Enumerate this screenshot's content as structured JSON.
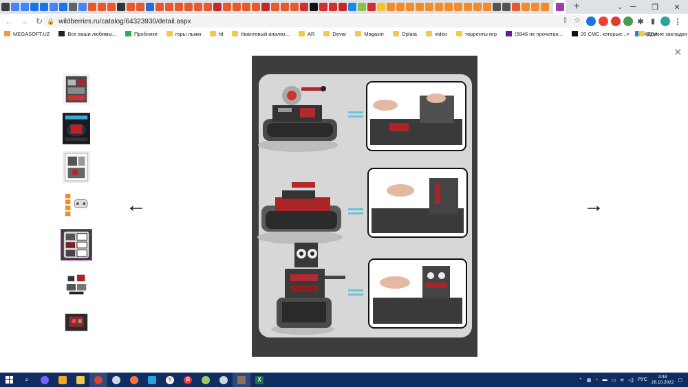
{
  "browser": {
    "active_tab_close": "×",
    "new_tab": "+",
    "tab_search": "⌄",
    "window": {
      "minimize": "─",
      "maximize": "❐",
      "close": "✕"
    },
    "url": "wildberries.ru/catalog/64323930/detail.aspx",
    "bookmarks": [
      {
        "label": "MEGASOFT.UZ",
        "color": "#e8a13a",
        "folder": false
      },
      {
        "label": "Все ваши любимы...",
        "color": "#222222",
        "folder": false
      },
      {
        "label": "Пробники",
        "color": "#34a853",
        "folder": false
      },
      {
        "label": "горы лыжи",
        "color": "#f2c94c",
        "folder": true
      },
      {
        "label": "fd",
        "color": "#f2c94c",
        "folder": true
      },
      {
        "label": "Квантовый анализ...",
        "color": "#f2c94c",
        "folder": true
      },
      {
        "label": "AR",
        "color": "#f2c94c",
        "folder": true
      },
      {
        "label": "Devar",
        "color": "#f2c94c",
        "folder": true
      },
      {
        "label": "Magazin",
        "color": "#f2c94c",
        "folder": true
      },
      {
        "label": "Oplata",
        "color": "#f2c94c",
        "folder": true
      },
      {
        "label": "video",
        "color": "#f2c94c",
        "folder": true
      },
      {
        "label": "торренты игр",
        "color": "#f2c94c",
        "folder": true
      },
      {
        "label": "(5946 не прочитан...",
        "color": "#6a1b9a",
        "folder": false
      },
      {
        "label": "20 СМС, которые...",
        "color": "#111111",
        "folder": false
      },
      {
        "label": "4PDA",
        "color": "#1e88e5",
        "folder": false
      }
    ],
    "bookmarks_more": "»",
    "other_bookmarks": "Другие закладки"
  },
  "viewer": {
    "close": "✕",
    "prev_arrow": "←",
    "next_arrow": "→",
    "active_thumbnail": 5,
    "thumbnail_count": 7
  },
  "taskbar": {
    "language": "РУС",
    "time": "3:48",
    "date": "26.10.2022"
  },
  "colors": {
    "accent_thumb_border": "#a23aa9",
    "taskbar_bg": "#0f2d62",
    "tabstrip_bg": "#dee1e6"
  }
}
